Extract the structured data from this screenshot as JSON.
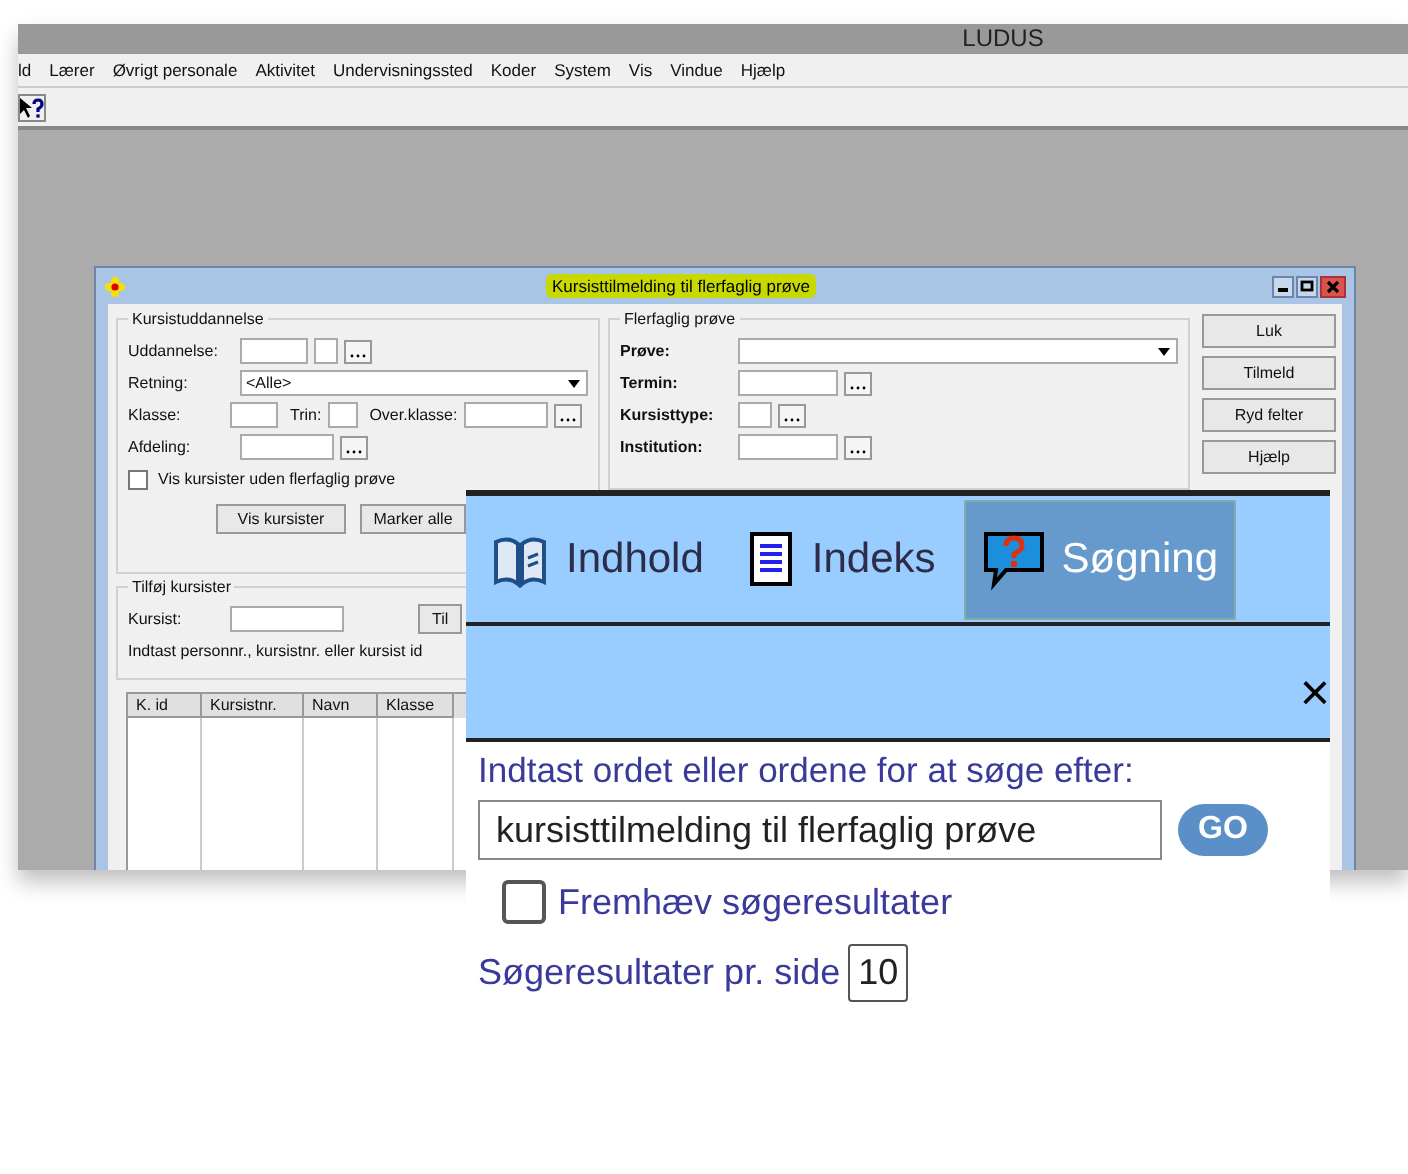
{
  "window": {
    "title": "LUDUS"
  },
  "menu": [
    "ld",
    "Lærer",
    "Øvrigt personale",
    "Aktivitet",
    "Undervisningssted",
    "Koder",
    "System",
    "Vis",
    "Vindue",
    "Hjælp"
  ],
  "dialog": {
    "title": "Kursisttilmelding til flerfaglig prøve",
    "education": {
      "title": "Kursistuddannelse",
      "uddannelse": "Uddannelse:",
      "retning": "Retning:",
      "retning_value": "<Alle>",
      "klasse": "Klasse:",
      "trin": "Trin:",
      "overklasse": "Over.klasse:",
      "afdeling": "Afdeling:",
      "checkbox": {
        "label": "Vis kursister uden flerfaglig prøve",
        "checked": false
      },
      "buttons": [
        "Vis kursister",
        "Marker alle"
      ]
    },
    "add": {
      "title": "Tilføj kursister",
      "kursist": "Kursist:",
      "button": "Til",
      "hint": "Indtast personnr., kursistnr. eller kursist id"
    },
    "table": {
      "columns": [
        "K. id",
        "Kursistnr.",
        "Navn",
        "Klasse"
      ]
    },
    "exam": {
      "title": "Flerfaglig prøve",
      "prove": "Prøve:",
      "termin": "Termin:",
      "kursisttype": "Kursisttype:",
      "institution": "Institution:"
    },
    "buttons": [
      "Luk",
      "Tilmeld",
      "Ryd felter",
      "Hjælp"
    ]
  },
  "help": {
    "tabs": [
      {
        "label": "Indhold",
        "kind": "book",
        "selected": false
      },
      {
        "label": "Indeks",
        "kind": "index",
        "selected": false
      },
      {
        "label": "Søgning",
        "kind": "search",
        "selected": true
      }
    ],
    "close": "×",
    "prompt": "Indtast ordet eller ordene for at søge efter:",
    "search_value": "kursisttilmelding til flerfaglig prøve",
    "go": "GO",
    "highlight": {
      "label": "Fremhæv søgeresultater",
      "checked": false
    },
    "per_page_label": "Søgeresultater pr. side",
    "per_page_value": "10"
  }
}
